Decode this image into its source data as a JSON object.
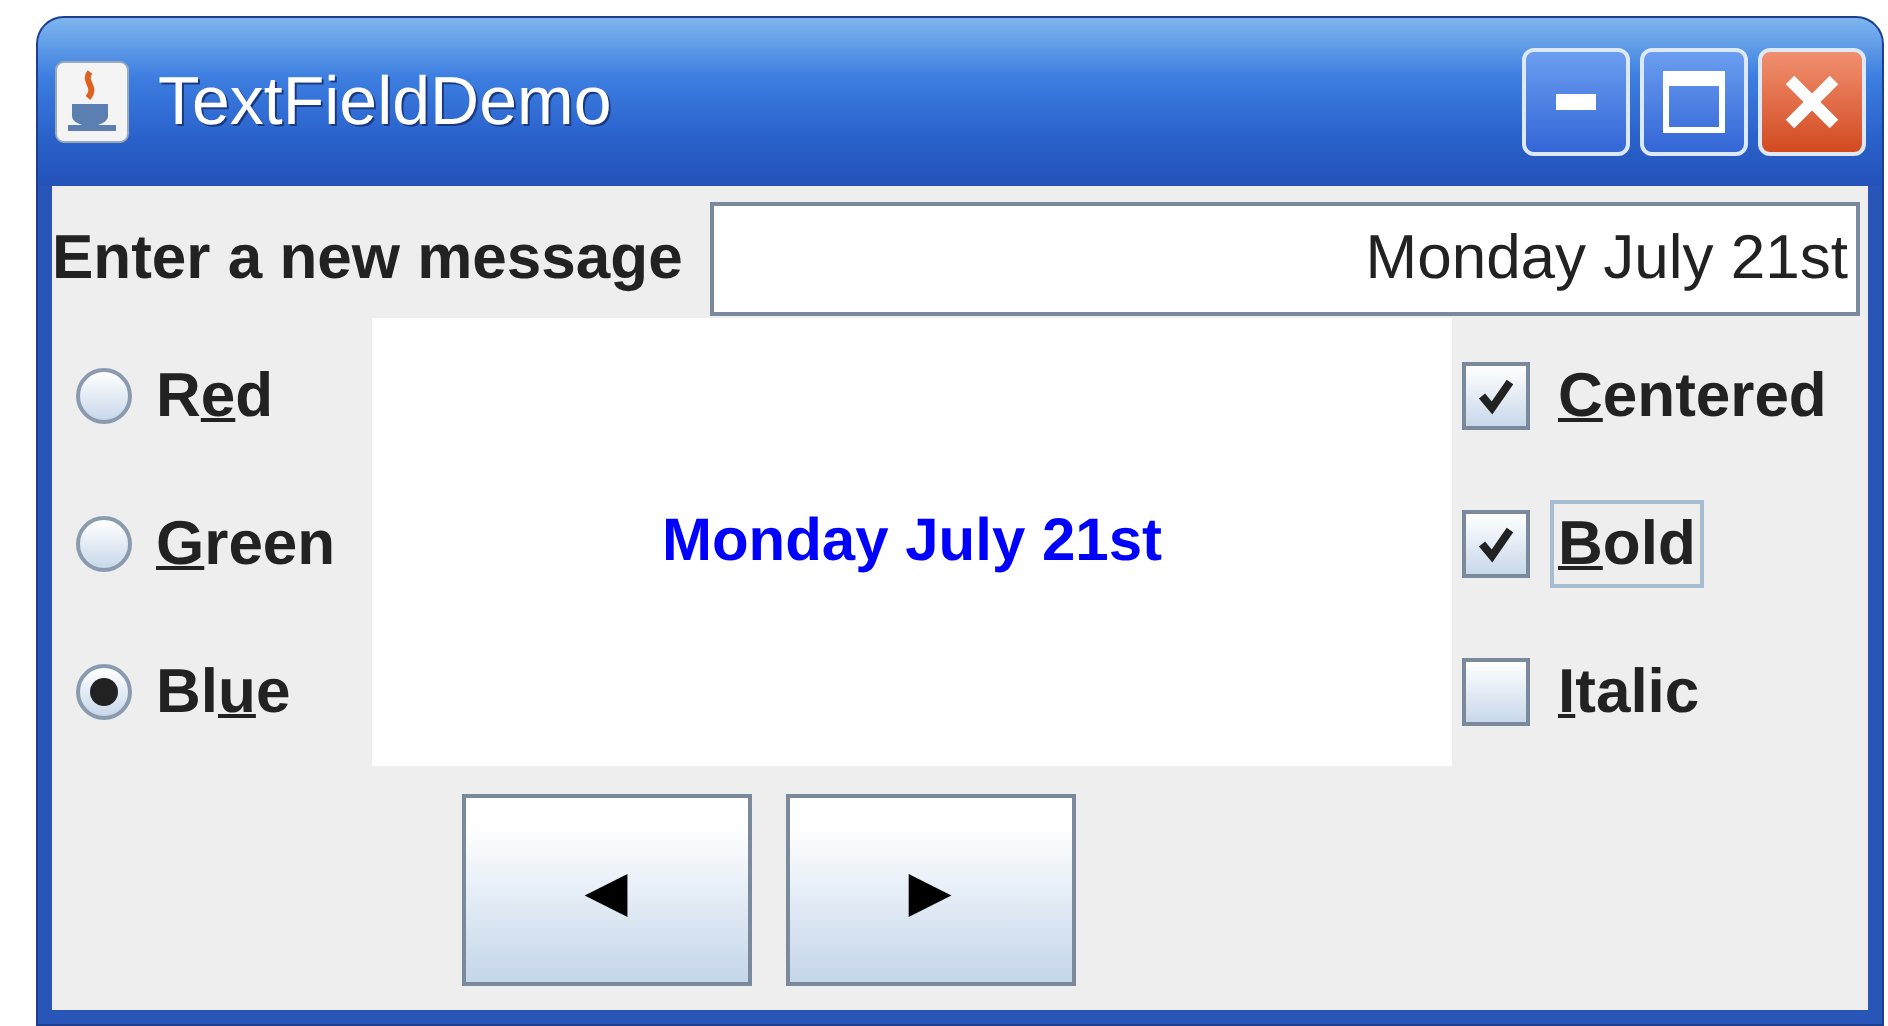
{
  "window": {
    "title": "TextFieldDemo"
  },
  "message_row": {
    "label": "Enter a new message",
    "value": "Monday July 21st"
  },
  "radios": [
    {
      "label": {
        "before": "R",
        "underlined": "e",
        "after": "d"
      },
      "selected": false
    },
    {
      "label": {
        "underlined": "G",
        "after": "reen"
      },
      "selected": false
    },
    {
      "label": {
        "before": "Bl",
        "underlined": "u",
        "after": "e"
      },
      "selected": true
    }
  ],
  "display": {
    "text": "Monday July 21st",
    "color": "#0000ff"
  },
  "checkboxes": [
    {
      "kind": "centered",
      "label": {
        "underlined": "C",
        "after": "entered"
      },
      "checked": true,
      "focused": false
    },
    {
      "kind": "bold",
      "label": {
        "underlined": "B",
        "after": "old"
      },
      "checked": true,
      "focused": true
    },
    {
      "kind": "italic",
      "label": {
        "underlined": "I",
        "after": "talic"
      },
      "checked": false,
      "focused": false
    }
  ],
  "buttons": [
    {
      "label": "◀"
    },
    {
      "label": "▶"
    }
  ]
}
